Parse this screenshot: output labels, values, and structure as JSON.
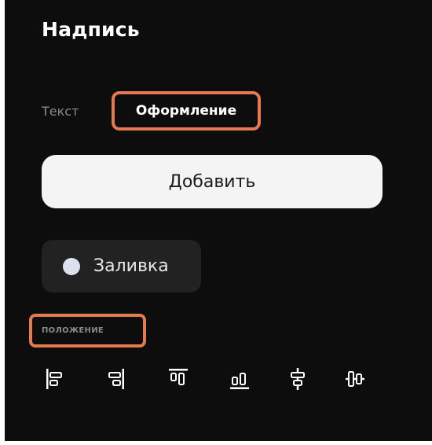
{
  "panel": {
    "title": "Надпись"
  },
  "tabs": [
    {
      "label": "Текст",
      "active": false
    },
    {
      "label": "Оформление",
      "active": true
    }
  ],
  "add_button": {
    "label": "Добавить"
  },
  "fill": {
    "label": "Заливка",
    "dot_color": "#dde1ee"
  },
  "position_section": {
    "label": "ПОЛОЖЕНИЕ",
    "align_buttons": [
      {
        "icon": "align-left-icon"
      },
      {
        "icon": "align-right-icon"
      },
      {
        "icon": "align-top-icon"
      },
      {
        "icon": "align-bottom-icon"
      },
      {
        "icon": "align-center-horizontal-icon"
      },
      {
        "icon": "align-center-vertical-icon"
      }
    ]
  },
  "colors": {
    "panel_bg": "#0d0d0d",
    "highlight": "#e57a4f",
    "button_bg": "#f4f4f4",
    "chip_bg": "#222222"
  }
}
